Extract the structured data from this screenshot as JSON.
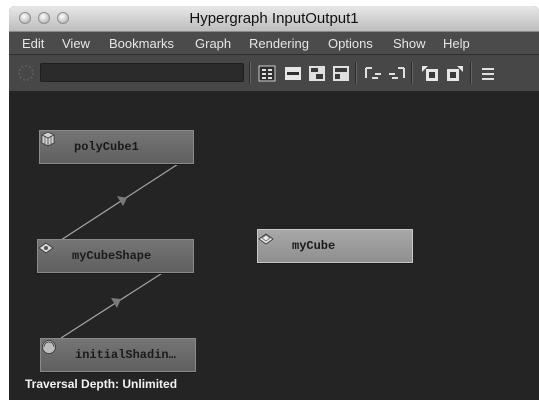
{
  "window": {
    "title": "Hypergraph InputOutput1"
  },
  "menubar": {
    "items": [
      "Edit",
      "View",
      "Bookmarks",
      "Graph",
      "Rendering",
      "Options",
      "Show",
      "Help"
    ]
  },
  "toolbar": {
    "filter_value": "",
    "icons": [
      "frame-all-icon",
      "collapse-icon",
      "input-connections-icon",
      "output-connections-icon",
      "upstream-icon",
      "downstream-icon",
      "graph-selected-icon",
      "clear-graph-icon",
      "layout-options-icon"
    ]
  },
  "graph": {
    "nodes": [
      {
        "id": "polyCube1",
        "label": "polyCube1",
        "icon": "poly-cube-icon",
        "selected": false
      },
      {
        "id": "myCubeShape",
        "label": "myCubeShape",
        "icon": "shape-node-icon",
        "selected": false
      },
      {
        "id": "initialShading",
        "label": "initialShadin…",
        "icon": "shading-group-icon",
        "selected": false
      },
      {
        "id": "myCube",
        "label": "myCube",
        "icon": "transform-node-icon",
        "selected": true
      }
    ],
    "connections": [
      {
        "from": "polyCube1",
        "to": "myCubeShape"
      },
      {
        "from": "myCubeShape",
        "to": "initialShading"
      }
    ]
  },
  "status": {
    "text": "Traversal Depth: Unlimited"
  }
}
